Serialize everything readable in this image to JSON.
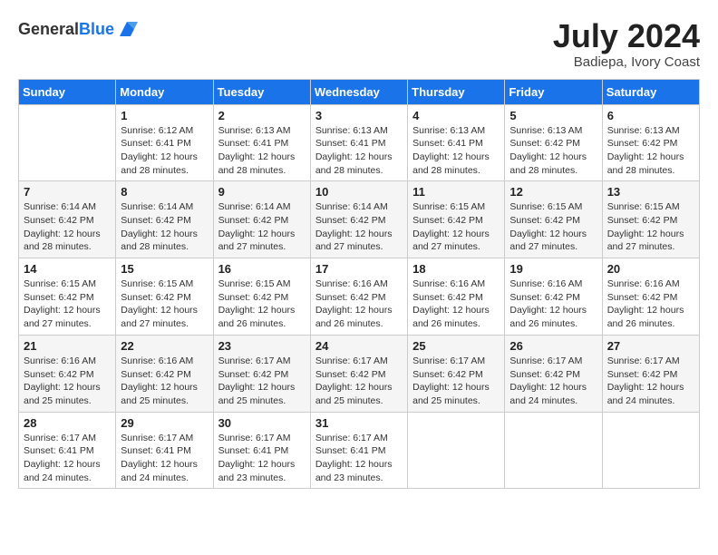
{
  "header": {
    "logo_general": "General",
    "logo_blue": "Blue",
    "month_year": "July 2024",
    "location": "Badiepa, Ivory Coast"
  },
  "weekdays": [
    "Sunday",
    "Monday",
    "Tuesday",
    "Wednesday",
    "Thursday",
    "Friday",
    "Saturday"
  ],
  "weeks": [
    [
      {
        "day": "",
        "sunrise": "",
        "sunset": "",
        "daylight": ""
      },
      {
        "day": "1",
        "sunrise": "Sunrise: 6:12 AM",
        "sunset": "Sunset: 6:41 PM",
        "daylight": "Daylight: 12 hours and 28 minutes."
      },
      {
        "day": "2",
        "sunrise": "Sunrise: 6:13 AM",
        "sunset": "Sunset: 6:41 PM",
        "daylight": "Daylight: 12 hours and 28 minutes."
      },
      {
        "day": "3",
        "sunrise": "Sunrise: 6:13 AM",
        "sunset": "Sunset: 6:41 PM",
        "daylight": "Daylight: 12 hours and 28 minutes."
      },
      {
        "day": "4",
        "sunrise": "Sunrise: 6:13 AM",
        "sunset": "Sunset: 6:41 PM",
        "daylight": "Daylight: 12 hours and 28 minutes."
      },
      {
        "day": "5",
        "sunrise": "Sunrise: 6:13 AM",
        "sunset": "Sunset: 6:42 PM",
        "daylight": "Daylight: 12 hours and 28 minutes."
      },
      {
        "day": "6",
        "sunrise": "Sunrise: 6:13 AM",
        "sunset": "Sunset: 6:42 PM",
        "daylight": "Daylight: 12 hours and 28 minutes."
      }
    ],
    [
      {
        "day": "7",
        "sunrise": "Sunrise: 6:14 AM",
        "sunset": "Sunset: 6:42 PM",
        "daylight": "Daylight: 12 hours and 28 minutes."
      },
      {
        "day": "8",
        "sunrise": "Sunrise: 6:14 AM",
        "sunset": "Sunset: 6:42 PM",
        "daylight": "Daylight: 12 hours and 28 minutes."
      },
      {
        "day": "9",
        "sunrise": "Sunrise: 6:14 AM",
        "sunset": "Sunset: 6:42 PM",
        "daylight": "Daylight: 12 hours and 27 minutes."
      },
      {
        "day": "10",
        "sunrise": "Sunrise: 6:14 AM",
        "sunset": "Sunset: 6:42 PM",
        "daylight": "Daylight: 12 hours and 27 minutes."
      },
      {
        "day": "11",
        "sunrise": "Sunrise: 6:15 AM",
        "sunset": "Sunset: 6:42 PM",
        "daylight": "Daylight: 12 hours and 27 minutes."
      },
      {
        "day": "12",
        "sunrise": "Sunrise: 6:15 AM",
        "sunset": "Sunset: 6:42 PM",
        "daylight": "Daylight: 12 hours and 27 minutes."
      },
      {
        "day": "13",
        "sunrise": "Sunrise: 6:15 AM",
        "sunset": "Sunset: 6:42 PM",
        "daylight": "Daylight: 12 hours and 27 minutes."
      }
    ],
    [
      {
        "day": "14",
        "sunrise": "Sunrise: 6:15 AM",
        "sunset": "Sunset: 6:42 PM",
        "daylight": "Daylight: 12 hours and 27 minutes."
      },
      {
        "day": "15",
        "sunrise": "Sunrise: 6:15 AM",
        "sunset": "Sunset: 6:42 PM",
        "daylight": "Daylight: 12 hours and 27 minutes."
      },
      {
        "day": "16",
        "sunrise": "Sunrise: 6:15 AM",
        "sunset": "Sunset: 6:42 PM",
        "daylight": "Daylight: 12 hours and 26 minutes."
      },
      {
        "day": "17",
        "sunrise": "Sunrise: 6:16 AM",
        "sunset": "Sunset: 6:42 PM",
        "daylight": "Daylight: 12 hours and 26 minutes."
      },
      {
        "day": "18",
        "sunrise": "Sunrise: 6:16 AM",
        "sunset": "Sunset: 6:42 PM",
        "daylight": "Daylight: 12 hours and 26 minutes."
      },
      {
        "day": "19",
        "sunrise": "Sunrise: 6:16 AM",
        "sunset": "Sunset: 6:42 PM",
        "daylight": "Daylight: 12 hours and 26 minutes."
      },
      {
        "day": "20",
        "sunrise": "Sunrise: 6:16 AM",
        "sunset": "Sunset: 6:42 PM",
        "daylight": "Daylight: 12 hours and 26 minutes."
      }
    ],
    [
      {
        "day": "21",
        "sunrise": "Sunrise: 6:16 AM",
        "sunset": "Sunset: 6:42 PM",
        "daylight": "Daylight: 12 hours and 25 minutes."
      },
      {
        "day": "22",
        "sunrise": "Sunrise: 6:16 AM",
        "sunset": "Sunset: 6:42 PM",
        "daylight": "Daylight: 12 hours and 25 minutes."
      },
      {
        "day": "23",
        "sunrise": "Sunrise: 6:17 AM",
        "sunset": "Sunset: 6:42 PM",
        "daylight": "Daylight: 12 hours and 25 minutes."
      },
      {
        "day": "24",
        "sunrise": "Sunrise: 6:17 AM",
        "sunset": "Sunset: 6:42 PM",
        "daylight": "Daylight: 12 hours and 25 minutes."
      },
      {
        "day": "25",
        "sunrise": "Sunrise: 6:17 AM",
        "sunset": "Sunset: 6:42 PM",
        "daylight": "Daylight: 12 hours and 25 minutes."
      },
      {
        "day": "26",
        "sunrise": "Sunrise: 6:17 AM",
        "sunset": "Sunset: 6:42 PM",
        "daylight": "Daylight: 12 hours and 24 minutes."
      },
      {
        "day": "27",
        "sunrise": "Sunrise: 6:17 AM",
        "sunset": "Sunset: 6:42 PM",
        "daylight": "Daylight: 12 hours and 24 minutes."
      }
    ],
    [
      {
        "day": "28",
        "sunrise": "Sunrise: 6:17 AM",
        "sunset": "Sunset: 6:41 PM",
        "daylight": "Daylight: 12 hours and 24 minutes."
      },
      {
        "day": "29",
        "sunrise": "Sunrise: 6:17 AM",
        "sunset": "Sunset: 6:41 PM",
        "daylight": "Daylight: 12 hours and 24 minutes."
      },
      {
        "day": "30",
        "sunrise": "Sunrise: 6:17 AM",
        "sunset": "Sunset: 6:41 PM",
        "daylight": "Daylight: 12 hours and 23 minutes."
      },
      {
        "day": "31",
        "sunrise": "Sunrise: 6:17 AM",
        "sunset": "Sunset: 6:41 PM",
        "daylight": "Daylight: 12 hours and 23 minutes."
      },
      {
        "day": "",
        "sunrise": "",
        "sunset": "",
        "daylight": ""
      },
      {
        "day": "",
        "sunrise": "",
        "sunset": "",
        "daylight": ""
      },
      {
        "day": "",
        "sunrise": "",
        "sunset": "",
        "daylight": ""
      }
    ]
  ]
}
